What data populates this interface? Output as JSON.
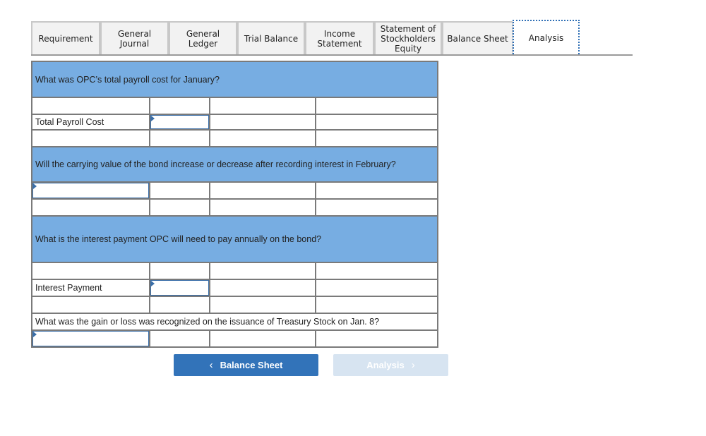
{
  "tabs": [
    {
      "label": "Requirement",
      "active": false
    },
    {
      "label": "General\nJournal",
      "active": false
    },
    {
      "label": "General\nLedger",
      "active": false
    },
    {
      "label": "Trial Balance",
      "active": false
    },
    {
      "label": "Income\nStatement",
      "active": false
    },
    {
      "label": "Statement of\nStockholders\nEquity",
      "active": false
    },
    {
      "label": "Balance Sheet",
      "active": false
    },
    {
      "label": "Analysis",
      "active": true
    }
  ],
  "questions": {
    "q1": {
      "text": "What was OPC’s total payroll cost for January?",
      "row_label": "Total Payroll Cost",
      "answer_value": ""
    },
    "q2": {
      "text": "Will the carrying value of the bond increase or decrease after recording interest in February?",
      "answer_value": ""
    },
    "q3": {
      "text": "What is the interest payment OPC will need to pay annually on the bond?",
      "row_label": "Interest Payment",
      "answer_value": ""
    },
    "q4": {
      "text": "What was the gain or loss was recognized on the issuance of Treasury Stock on Jan. 8?",
      "answer_value": ""
    }
  },
  "navigation": {
    "prev_label": "Balance Sheet",
    "prev_icon": "chevron-left-icon",
    "next_label": "Analysis",
    "next_icon": "chevron-right-icon",
    "next_disabled": true
  },
  "colors": {
    "question_band": "#77ade2",
    "primary_button": "#3273b9",
    "disabled_button": "#d7e4f1",
    "input_border": "#3a6ea8",
    "active_tab_outline": "#2f6fb5"
  }
}
